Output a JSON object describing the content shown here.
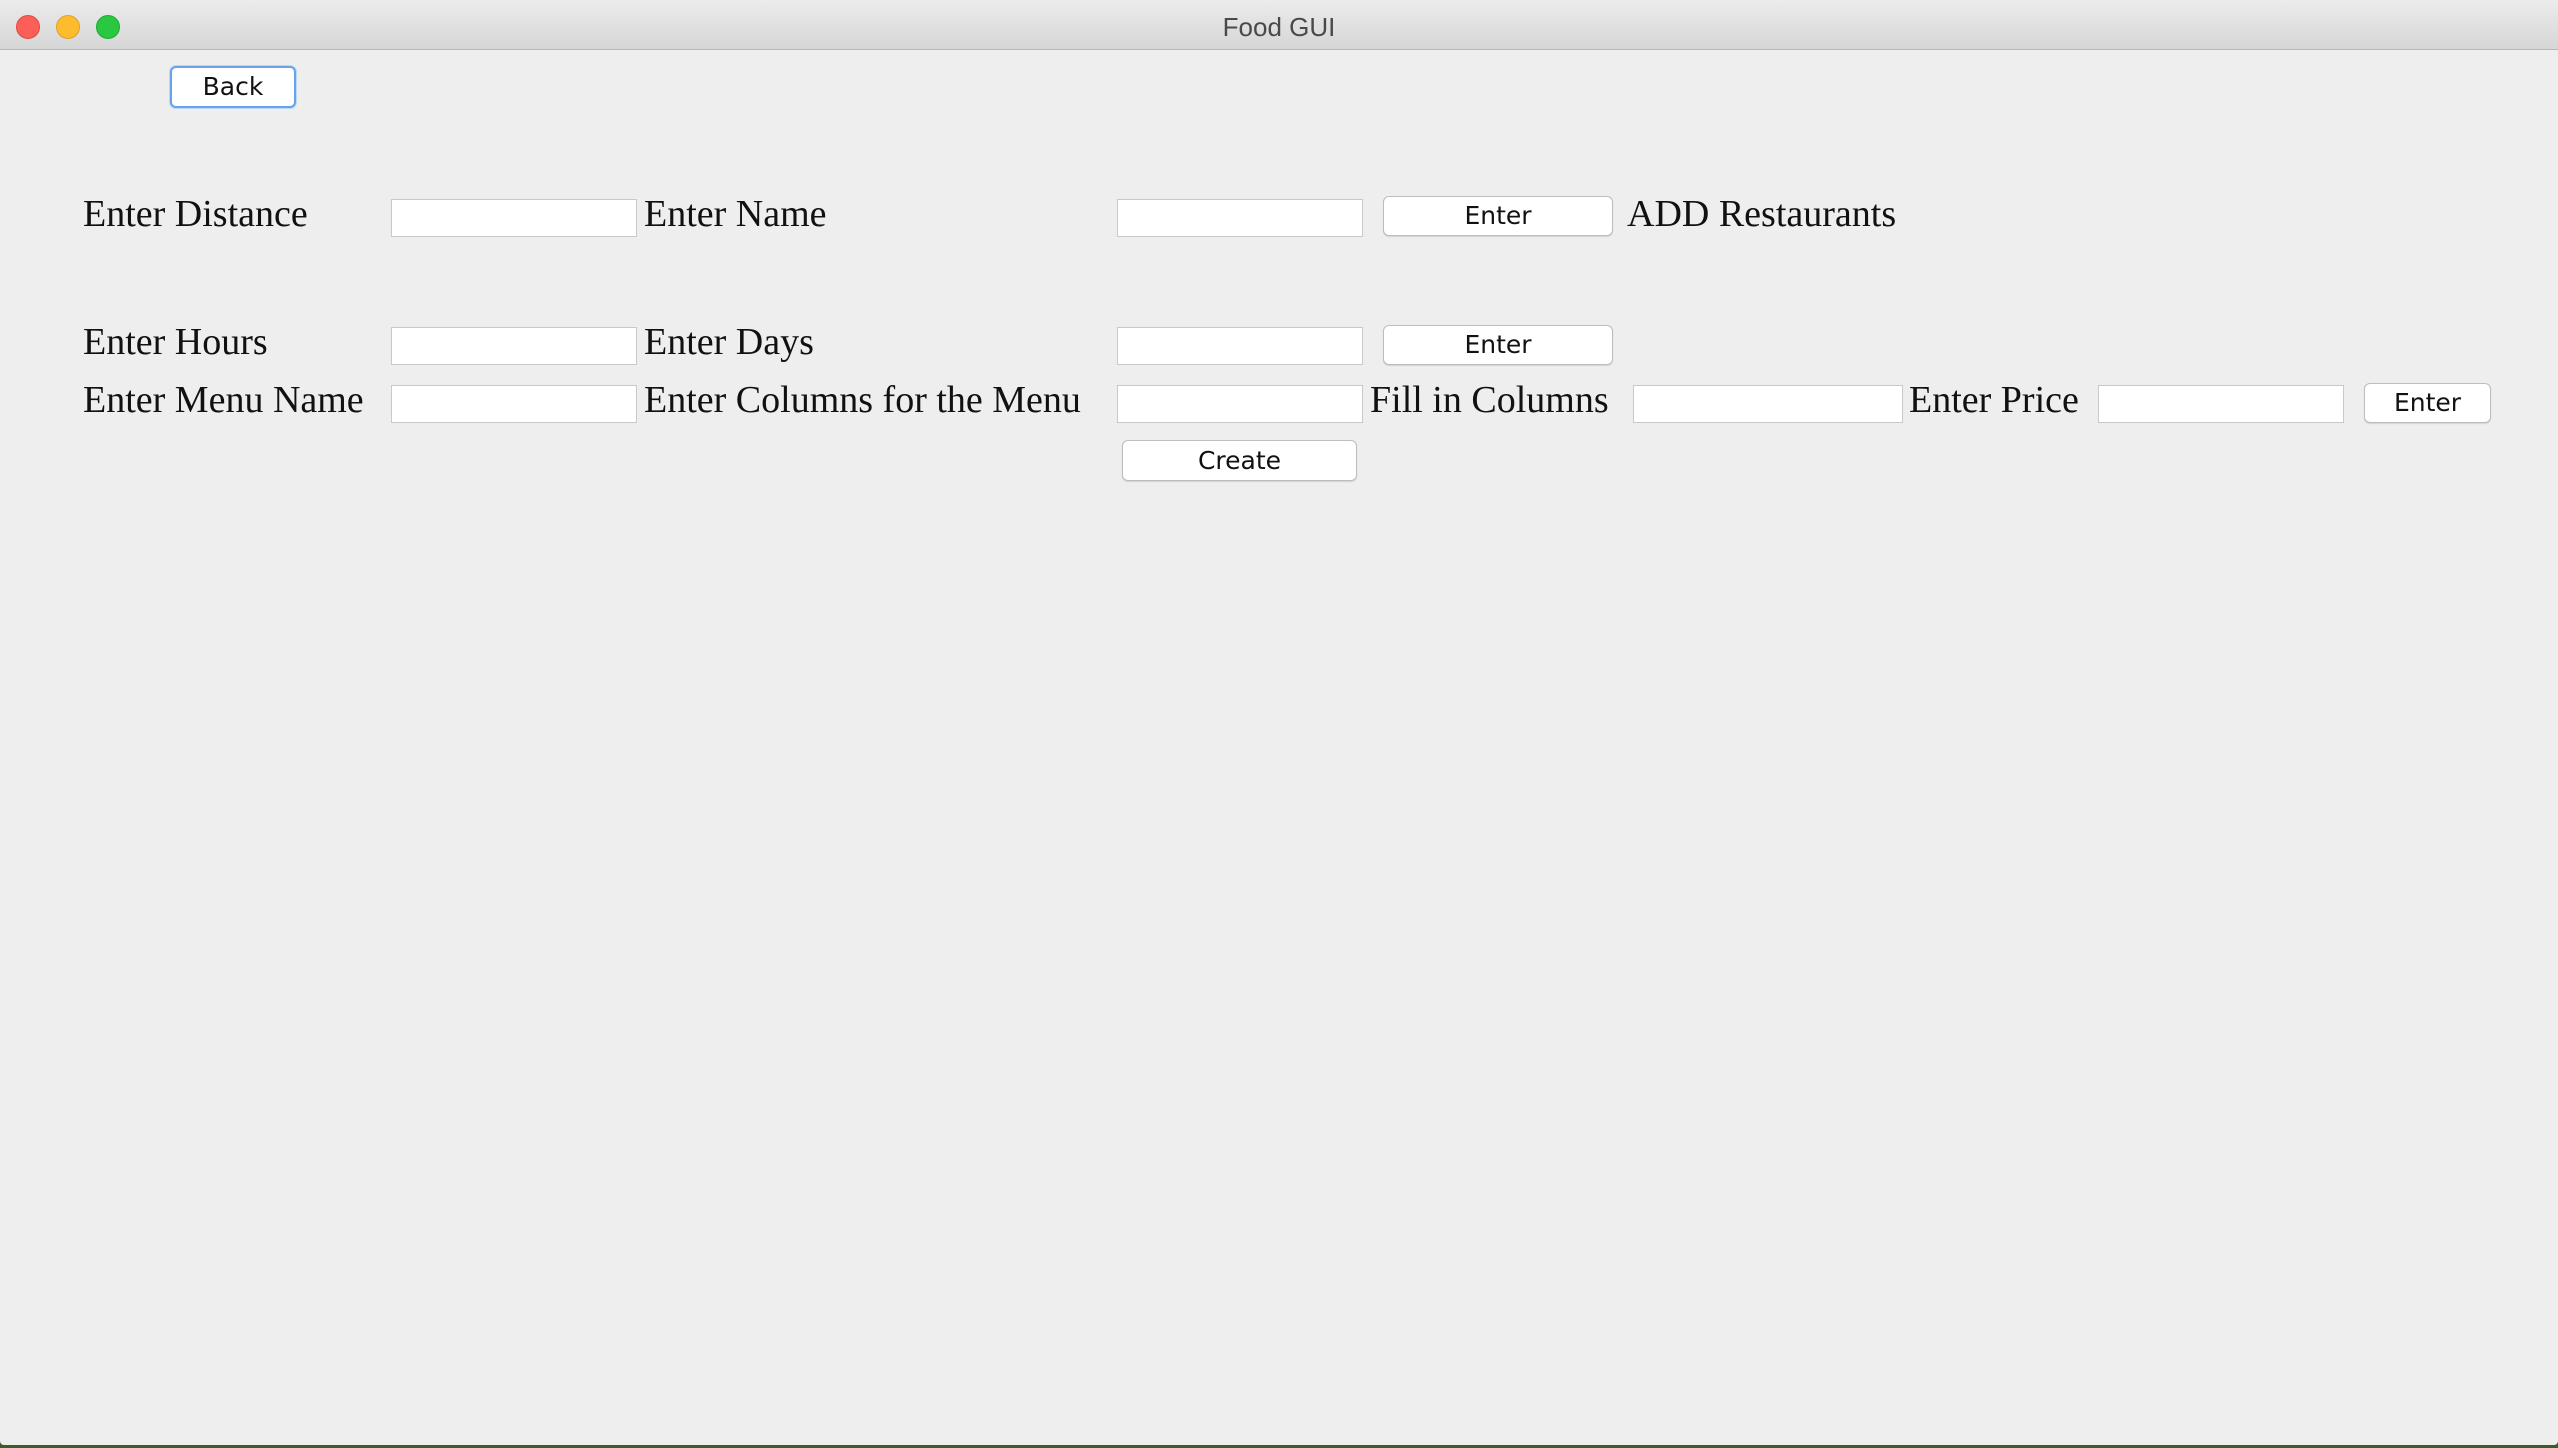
{
  "window": {
    "title": "Food GUI"
  },
  "back_button": "Back",
  "row1": {
    "distance_label": "Enter Distance",
    "distance_value": "",
    "name_label": "Enter Name",
    "name_value": "",
    "enter_button": "Enter",
    "add_restaurants_label": "ADD Restaurants"
  },
  "row2": {
    "hours_label": "Enter Hours",
    "hours_value": "",
    "days_label": "Enter Days",
    "days_value": "",
    "enter_button": "Enter"
  },
  "row3": {
    "menu_name_label": "Enter Menu Name",
    "menu_name_value": "",
    "columns_label": "Enter Columns for the Menu",
    "columns_value": "",
    "fill_columns_label": "Fill in Columns",
    "fill_columns_value": "",
    "price_label": "Enter Price",
    "price_value": "",
    "enter_button": "Enter"
  },
  "create_button": "Create"
}
